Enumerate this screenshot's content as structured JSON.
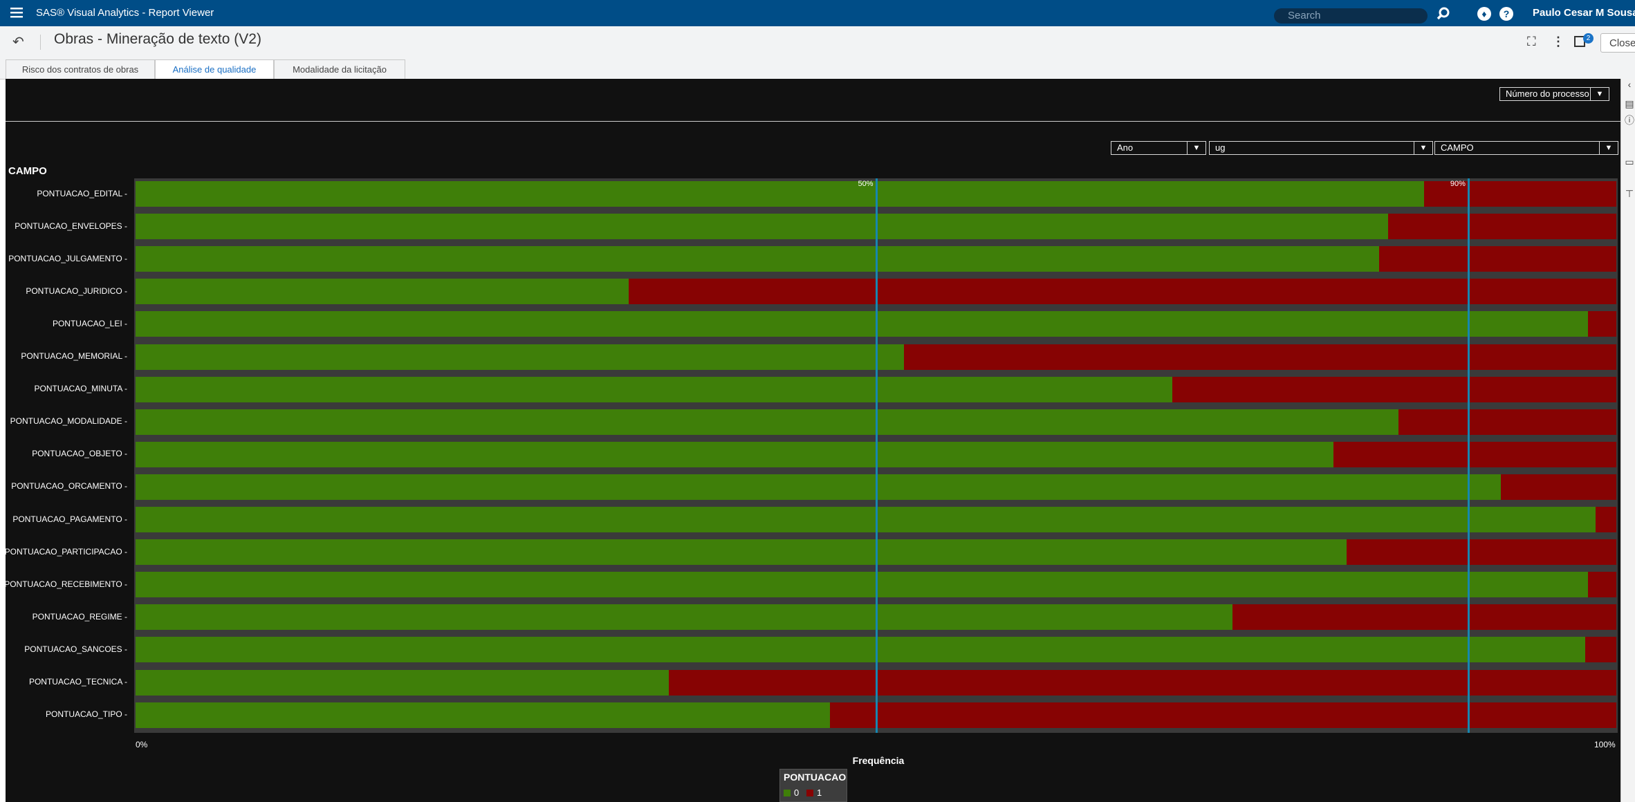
{
  "app": {
    "title": "SAS® Visual Analytics - Report Viewer",
    "search_placeholder": "Search",
    "user": "Paulo Cesar M Sousa J",
    "notification_icon": "bell-icon",
    "help_icon": "help-icon"
  },
  "report": {
    "title": "Obras - Mineração de texto (V2)",
    "badge_count": "2",
    "close_label": "Close"
  },
  "tabs": [
    {
      "label": "Risco dos contratos de obras"
    },
    {
      "label": "Análise de qualidade",
      "active": true
    },
    {
      "label": "Modalidade da licitação"
    }
  ],
  "filters": {
    "numero_processo": "Número do processo",
    "ano": "Ano",
    "ug": "ug",
    "campo": "CAMPO"
  },
  "colors": {
    "green": "#3f7f09",
    "red": "#870303",
    "refline": "#1686b0",
    "accent": "#004d87"
  },
  "chart_data": {
    "type": "bar",
    "orientation": "horizontal",
    "stacked": "100%",
    "ytitle": "CAMPO",
    "xlabel": "Frequência",
    "x_ticks": [
      "0%",
      "100%"
    ],
    "reference_lines": [
      {
        "label": "50%",
        "value": 50
      },
      {
        "label": "90%",
        "value": 90
      }
    ],
    "legend": {
      "title": "PONTUACAO",
      "entries": [
        "0",
        "1"
      ],
      "placement": "bottom-center"
    },
    "categories": [
      "PONTUACAO_EDITAL",
      "PONTUACAO_ENVELOPES",
      "PONTUACAO_JULGAMENTO",
      "PONTUACAO_JURIDICO",
      "PONTUACAO_LEI",
      "PONTUACAO_MEMORIAL",
      "PONTUACAO_MINUTA",
      "PONTUACAO_MODALIDADE",
      "PONTUACAO_OBJETO",
      "PONTUACAO_ORCAMENTO",
      "PONTUACAO_PAGAMENTO",
      "PONTUACAO_PARTICIPACAO",
      "PONTUACAO_RECEBIMENTO",
      "PONTUACAO_REGIME",
      "PONTUACAO_SANCOES",
      "PONTUACAO_TECNICA",
      "PONTUACAO_TIPO"
    ],
    "series": [
      {
        "name": "0",
        "values": [
          87,
          84.6,
          84,
          33.3,
          98.1,
          51.9,
          70,
          85.3,
          80.9,
          92.2,
          98.6,
          81.8,
          98.1,
          74.1,
          97.9,
          36,
          46.9
        ]
      },
      {
        "name": "1",
        "values": [
          13,
          15.4,
          16,
          66.7,
          1.9,
          48.1,
          30,
          14.7,
          19.1,
          7.8,
          1.4,
          18.2,
          1.9,
          25.9,
          2.1,
          64,
          53.1
        ]
      }
    ]
  }
}
